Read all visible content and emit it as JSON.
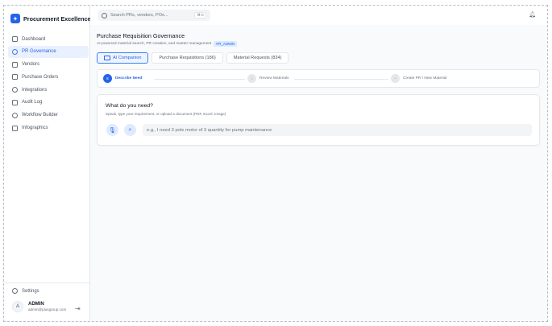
{
  "app": {
    "title": "Procurement Excellence"
  },
  "sidebar": {
    "items": [
      {
        "label": "Dashboard",
        "active": false
      },
      {
        "label": "PR Governance",
        "active": true
      },
      {
        "label": "Vendors",
        "active": false
      },
      {
        "label": "Purchase Orders",
        "active": false
      },
      {
        "label": "Integrations",
        "active": false
      },
      {
        "label": "Audit Log",
        "active": false
      },
      {
        "label": "Workflow Builder",
        "active": false
      },
      {
        "label": "Infographics",
        "active": false
      }
    ],
    "settings_label": "Settings",
    "user": {
      "initial": "A",
      "name": "ADMIN",
      "email": "admin@plusgroup.com"
    }
  },
  "header": {
    "search_placeholder": "Search PRs, vendors, POs...",
    "shortcut": "⌘ K"
  },
  "page": {
    "title": "Purchase Requisition Governance",
    "subtitle": "AI-powered material search, PR creation, and master management",
    "role_badge": "PR_ADMIN"
  },
  "tabs": [
    {
      "label": "AI Companion",
      "active": true
    },
    {
      "label": "Purchase Requisitions (186)",
      "active": false
    },
    {
      "label": "Material Requests (834)",
      "active": false
    }
  ],
  "steps": [
    {
      "label": "Describe Need",
      "active": true
    },
    {
      "label": "Review Materials",
      "active": false
    },
    {
      "label": "Create PR / New Material",
      "active": false
    }
  ],
  "card": {
    "title": "What do you need?",
    "subtitle": "Speak, type your requirement, or upload a document (PDF, Excel, Image)",
    "input_placeholder": "e.g., I need 3 pole motor of 3 quantity for pump maintenance"
  },
  "colors": {
    "accent": "#2563eb",
    "active_bg": "#eaf1fe",
    "border": "#e5e7eb"
  }
}
